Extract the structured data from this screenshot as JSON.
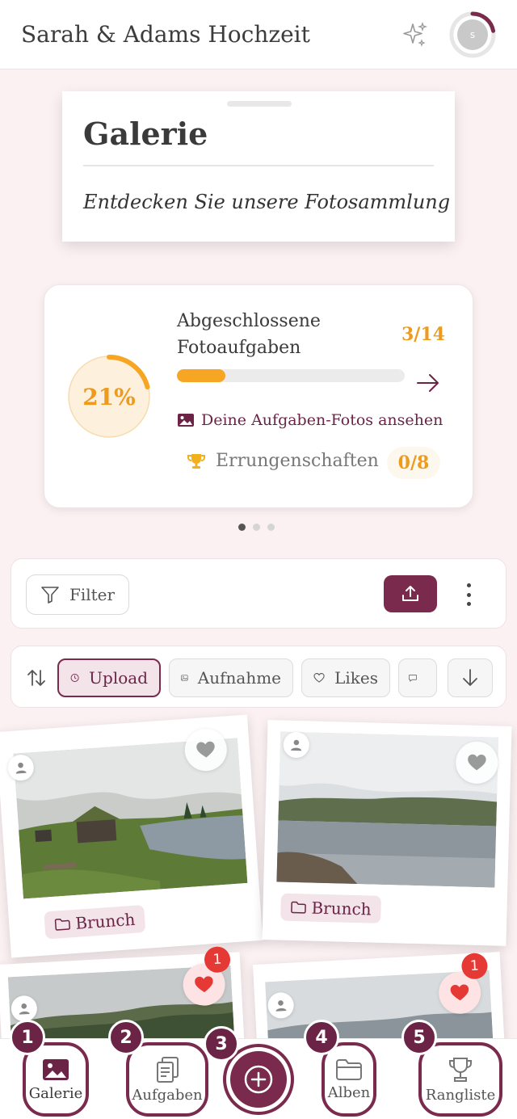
{
  "header": {
    "title": "Sarah & Adams Hochzeit",
    "avatar_initial": "s",
    "sparkle_icon": "sparkle-icon"
  },
  "gallery": {
    "title": "Galerie",
    "subtitle": "Entdecken Sie unsere Fotosammlung"
  },
  "progress": {
    "percent_label": "21%",
    "percent": 0.21,
    "task_title": "Abgeschlossene Fotoaufgaben",
    "task_count": "3/14",
    "bar_fraction": 0.214,
    "photos_link": "Deine Aufgaben-Fotos ansehen",
    "achievements_label": "Errungenschaften",
    "achievements_count": "0/8",
    "accent": "#ee9a1d"
  },
  "carousel": {
    "pages": 3,
    "active": 0
  },
  "toolbar": {
    "filter_label": "Filter",
    "upload_icon": "upload-icon",
    "more_icon": "kebab-menu-icon"
  },
  "sort": {
    "chips": [
      {
        "label": "Upload",
        "icon": "clock-icon",
        "active": true
      },
      {
        "label": "Aufnahme",
        "icon": "image-icon",
        "active": false
      },
      {
        "label": "Likes",
        "icon": "heart-outline-icon",
        "active": false
      },
      {
        "label": "",
        "icon": "comment-icon",
        "active": false
      }
    ],
    "direction_icon": "arrow-down-icon"
  },
  "photos": [
    {
      "album": "Brunch",
      "liked": false,
      "likes": ""
    },
    {
      "album": "Brunch",
      "liked": false,
      "likes": ""
    },
    {
      "album": "",
      "liked": true,
      "likes": "1"
    },
    {
      "album": "",
      "liked": true,
      "likes": "1"
    }
  ],
  "nav": {
    "items": [
      {
        "label": "Galerie",
        "badge": "1"
      },
      {
        "label": "Aufgaben",
        "badge": "2"
      },
      {
        "label": "",
        "badge": "3"
      },
      {
        "label": "Alben",
        "badge": "4"
      },
      {
        "label": "Rangliste",
        "badge": "5"
      }
    ]
  },
  "colors": {
    "brand": "#7a2a4c",
    "background": "#fbf1f3",
    "like": "#e53935"
  }
}
